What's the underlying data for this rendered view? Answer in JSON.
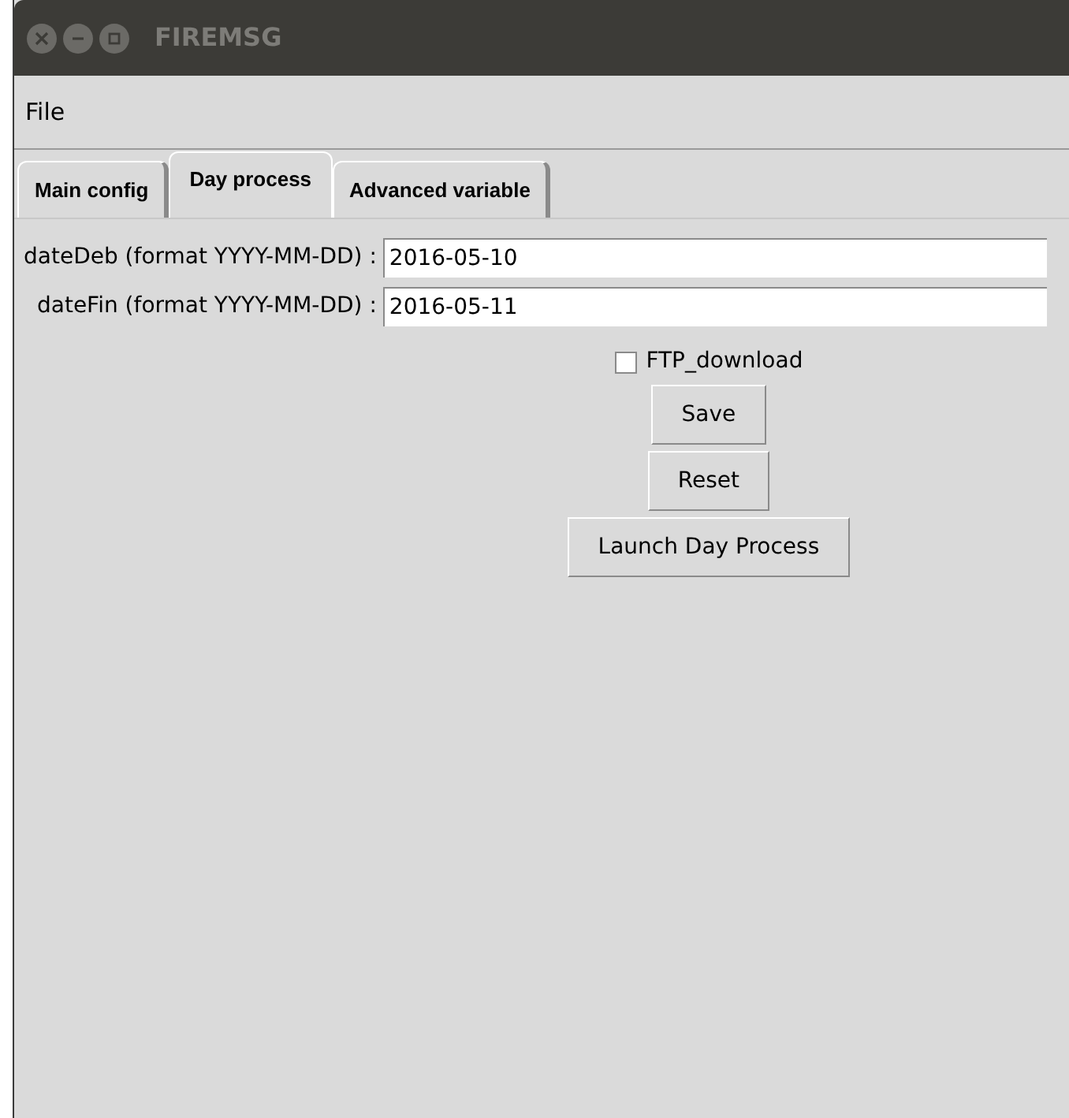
{
  "window": {
    "title": "FIREMSG"
  },
  "menu": [
    "File"
  ],
  "tabs": [
    {
      "label": "Main config",
      "selected": false
    },
    {
      "label": "Day process",
      "selected": true
    },
    {
      "label": "Advanced variable",
      "selected": false
    }
  ],
  "fields": [
    {
      "label": "dateDeb (format YYYY-MM-DD) :",
      "value": "2016-05-10"
    },
    {
      "label": "dateFin (format YYYY-MM-DD) :",
      "value": "2016-05-11"
    }
  ],
  "checkbox": {
    "label": "FTP_download",
    "checked": false
  },
  "buttons": [
    "Save",
    "Reset",
    "Launch Day Process"
  ]
}
